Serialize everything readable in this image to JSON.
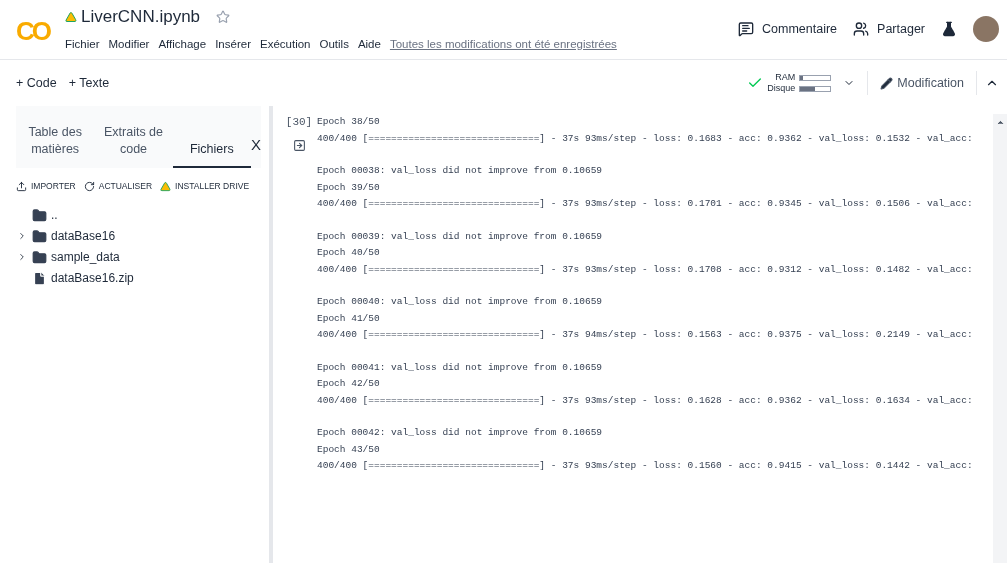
{
  "header": {
    "logo": "CO",
    "title": "LiverCNN.ipynb",
    "starred": false,
    "menu": [
      "Fichier",
      "Modifier",
      "Affichage",
      "Insérer",
      "Exécution",
      "Outils",
      "Aide"
    ],
    "save_status": "Toutes les modifications ont été enregistrées",
    "actions": [
      {
        "kind": "comment",
        "label": "Commentaire"
      },
      {
        "kind": "share",
        "label": "Partager"
      }
    ]
  },
  "toolbar": {
    "insert": [
      "+ Code",
      "+ Texte"
    ],
    "connected": true,
    "meters": [
      {
        "label": "RAM",
        "level": 0.1
      },
      {
        "label": "Disque",
        "level": 0.5
      }
    ],
    "mode": "Modification"
  },
  "sidebar": {
    "tabs": [
      {
        "label": "Table des matières",
        "selected": false
      },
      {
        "label": "Extraits de code",
        "selected": false
      },
      {
        "label": "Fichiers",
        "selected": true
      }
    ],
    "close": "X",
    "actions": [
      {
        "kind": "upload",
        "label": "IMPORTER"
      },
      {
        "kind": "refresh",
        "label": "ACTUALISER"
      },
      {
        "kind": "drive",
        "label": "INSTALLER DRIVE"
      }
    ],
    "files": [
      {
        "kind": "parent",
        "name": ".."
      },
      {
        "kind": "folder",
        "name": "dataBase16",
        "expanded": false
      },
      {
        "kind": "folder",
        "name": "sample_data",
        "expanded": false
      },
      {
        "kind": "file",
        "name": "dataBase16.zip"
      }
    ]
  },
  "cell": {
    "execution_count": "[30]",
    "output": [
      [
        "Epoch 38/50",
        "400/400 [==============================] - 37s 93ms/step - loss: 0.1683 - acc: 0.9362 - val_loss: 0.1532 - val_acc:"
      ],
      [
        "Epoch 00038: val_loss did not improve from 0.10659",
        "Epoch 39/50",
        "400/400 [==============================] - 37s 93ms/step - loss: 0.1701 - acc: 0.9345 - val_loss: 0.1506 - val_acc:"
      ],
      [
        "Epoch 00039: val_loss did not improve from 0.10659",
        "Epoch 40/50",
        "400/400 [==============================] - 37s 93ms/step - loss: 0.1708 - acc: 0.9312 - val_loss: 0.1482 - val_acc:"
      ],
      [
        "Epoch 00040: val_loss did not improve from 0.10659",
        "Epoch 41/50",
        "400/400 [==============================] - 37s 94ms/step - loss: 0.1563 - acc: 0.9375 - val_loss: 0.2149 - val_acc:"
      ],
      [
        "Epoch 00041: val_loss did not improve from 0.10659",
        "Epoch 42/50",
        "400/400 [==============================] - 37s 93ms/step - loss: 0.1628 - acc: 0.9362 - val_loss: 0.1634 - val_acc:"
      ],
      [
        "Epoch 00042: val_loss did not improve from 0.10659",
        "Epoch 43/50",
        "400/400 [==============================] - 37s 93ms/step - loss: 0.1560 - acc: 0.9415 - val_loss: 0.1442 - val_acc:"
      ]
    ]
  }
}
